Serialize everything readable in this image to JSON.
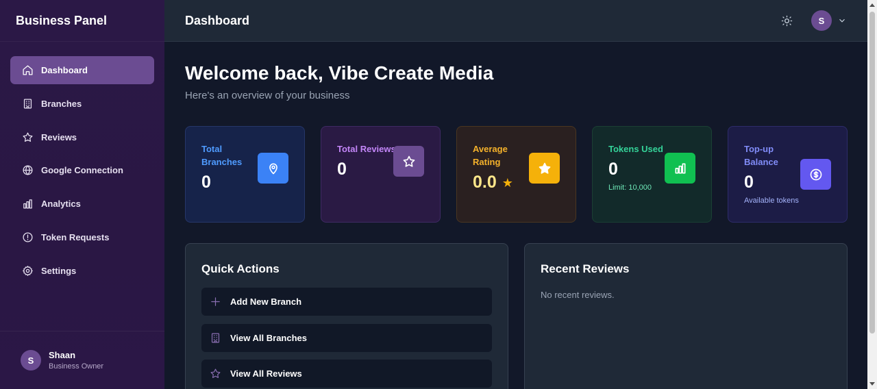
{
  "sidebar": {
    "brand": "Business Panel",
    "items": [
      {
        "label": "Dashboard",
        "icon": "home-icon"
      },
      {
        "label": "Branches",
        "icon": "building-icon"
      },
      {
        "label": "Reviews",
        "icon": "star-icon"
      },
      {
        "label": "Google Connection",
        "icon": "globe-icon"
      },
      {
        "label": "Analytics",
        "icon": "bar-chart-icon"
      },
      {
        "label": "Token Requests",
        "icon": "alert-circle-icon"
      },
      {
        "label": "Settings",
        "icon": "gear-icon"
      }
    ],
    "active_index": 0,
    "user": {
      "initial": "S",
      "name": "Shaan",
      "role": "Business Owner"
    }
  },
  "header": {
    "title": "Dashboard",
    "avatar_initial": "S"
  },
  "main": {
    "welcome": "Welcome back, Vibe Create Media",
    "subtitle": "Here's an overview of your business",
    "cards": [
      {
        "label": "Total Branches",
        "value": "0",
        "note": "",
        "icon": "map-pin-icon",
        "color": "#3b82f6"
      },
      {
        "label": "Total Reviews",
        "value": "0",
        "note": "",
        "icon": "star-icon",
        "color": "#6b4c92"
      },
      {
        "label": "Average Rating",
        "value": "0.0",
        "note": "",
        "icon": "star-icon",
        "color": "#f5b10a"
      },
      {
        "label": "Tokens Used",
        "value": "0",
        "note": "Limit: 10,000",
        "icon": "bar-chart-icon",
        "color": "#10c051"
      },
      {
        "label": "Top-up Balance",
        "value": "0",
        "note": "Available tokens",
        "icon": "dollar-coin-icon",
        "color": "#6358f0"
      }
    ],
    "quick_actions": {
      "title": "Quick Actions",
      "items": [
        {
          "label": "Add New Branch",
          "icon": "plus-icon"
        },
        {
          "label": "View All Branches",
          "icon": "building-icon"
        },
        {
          "label": "View All Reviews",
          "icon": "star-icon"
        }
      ]
    },
    "recent_reviews": {
      "title": "Recent Reviews",
      "empty_text": "No recent reviews."
    }
  }
}
